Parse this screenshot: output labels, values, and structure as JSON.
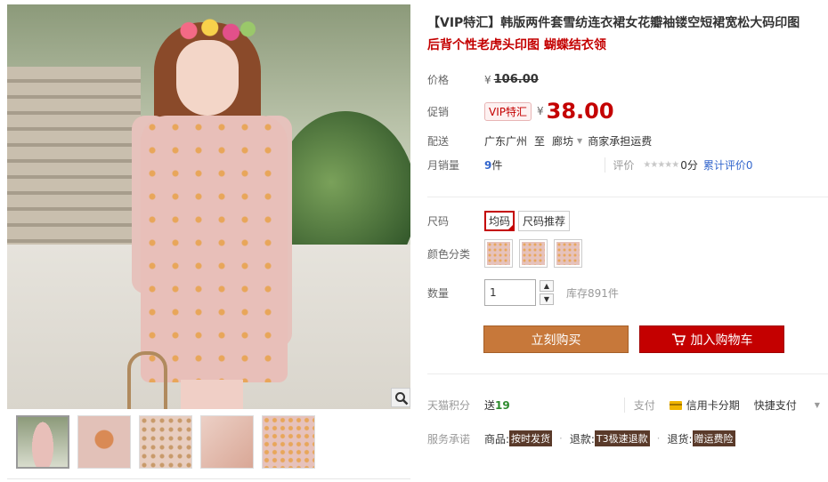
{
  "product": {
    "title": "【VIP特汇】韩版两件套雪纺连衣裙女花瓣袖镂空短裙宽松大码印图",
    "subtitle": "后背个性老虎头印图 蝴蝶结衣领"
  },
  "price": {
    "label": "价格",
    "currency": "¥",
    "original": "106.00"
  },
  "promo": {
    "label": "促销",
    "tag": "VIP特汇",
    "currency": "¥",
    "value": "38.00"
  },
  "shipping": {
    "label": "配送",
    "from": "广东广州",
    "to_word": "至",
    "destination": "廊坊",
    "fee_note": "商家承担运费"
  },
  "sales": {
    "label": "月销量",
    "count": "9",
    "unit": "件",
    "rating_label": "评价",
    "stars": "★★★★★",
    "score": "0分",
    "review_link": "累计评价0"
  },
  "size": {
    "label": "尺码",
    "options": [
      "均码",
      "尺码推荐"
    ]
  },
  "color": {
    "label": "颜色分类"
  },
  "quantity": {
    "label": "数量",
    "value": "1",
    "stock": "库存891件"
  },
  "actions": {
    "buy_now": "立刻购买",
    "add_to_cart": "加入购物车"
  },
  "points": {
    "label": "天猫积分",
    "give": "送",
    "amount": "19",
    "pay_label": "支付",
    "installment": "信用卡分期",
    "quick_pay": "快捷支付"
  },
  "promise": {
    "label": "服务承诺",
    "goods_label": "商品:",
    "goods_tag": "按时发货",
    "refund_label": "退款:",
    "refund_tag": "T3极速退款",
    "return_label": "退货:",
    "return_tag": "赠运费险"
  },
  "colors": {
    "accent": "#c40000",
    "buy_button": "#c7783a",
    "link": "#3366cc"
  }
}
